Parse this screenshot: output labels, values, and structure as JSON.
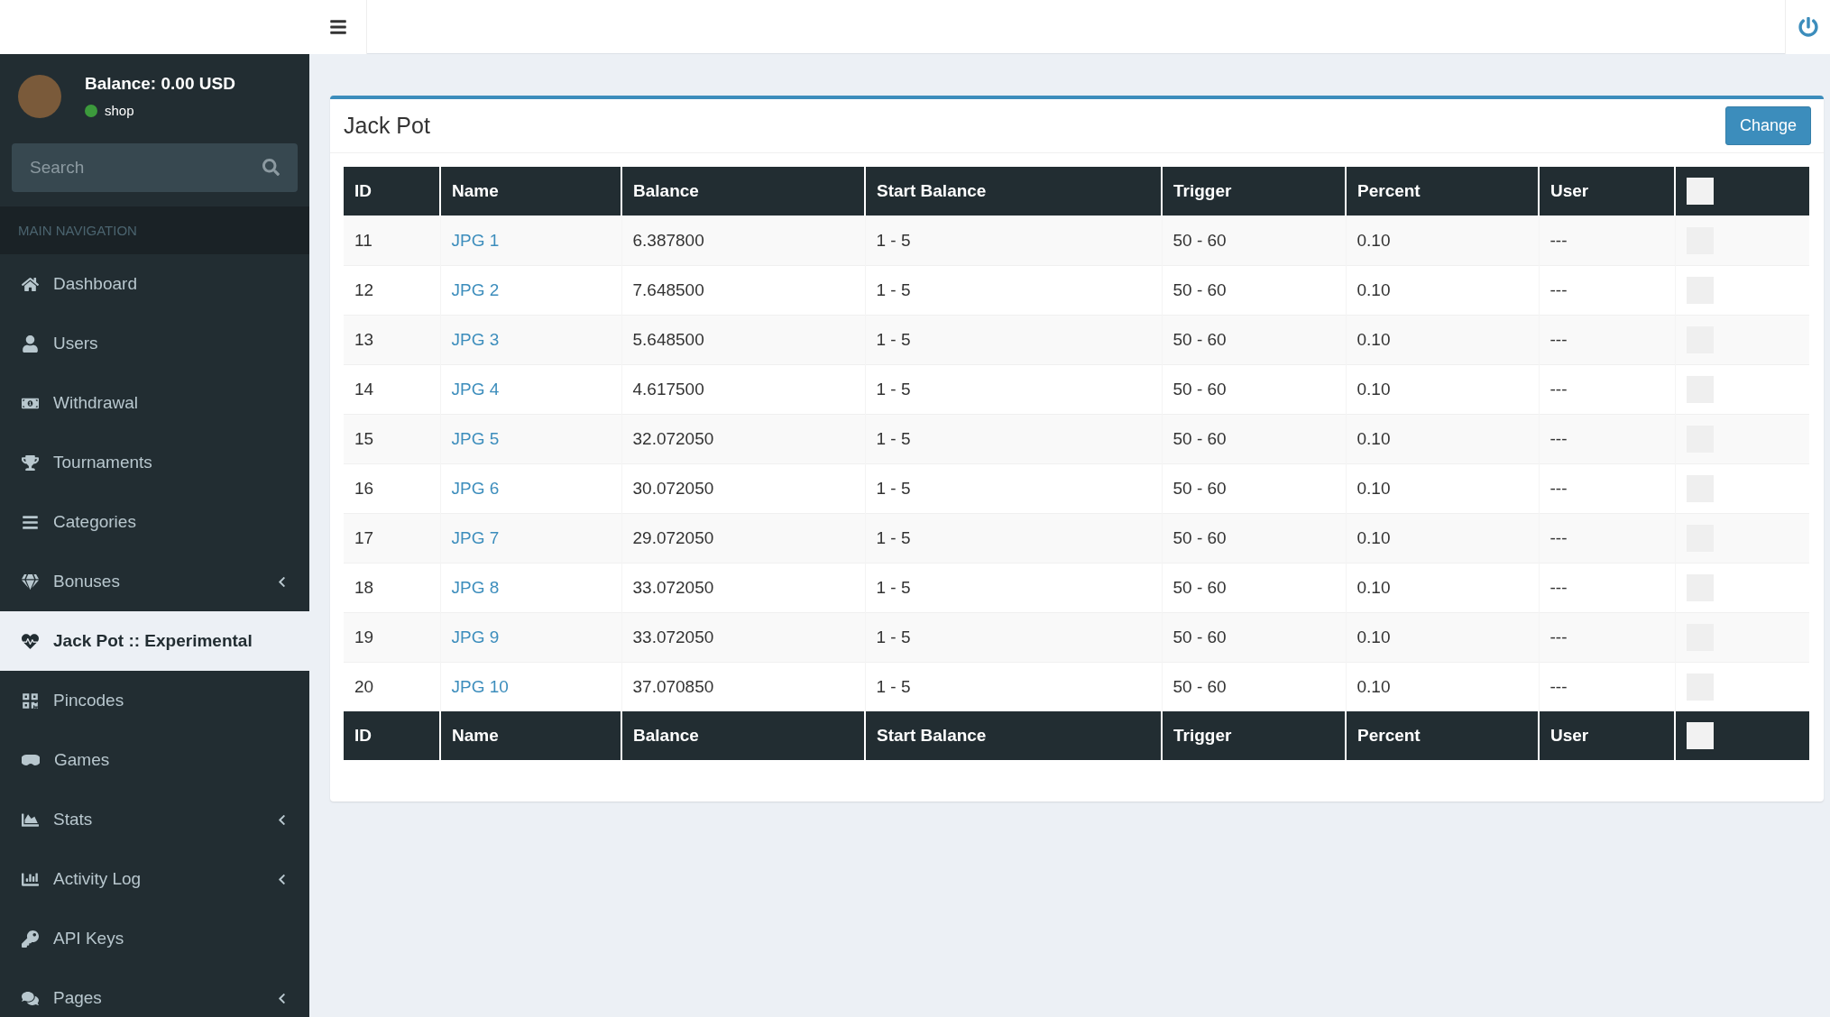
{
  "sidebar": {
    "user": {
      "balance": "Balance: 0.00 USD",
      "status": "shop"
    },
    "search": {
      "placeholder": "Search"
    },
    "nav_header": "MAIN NAVIGATION",
    "items": [
      {
        "label": "Dashboard",
        "selected": false,
        "has_submenu": false
      },
      {
        "label": "Users",
        "selected": false,
        "has_submenu": false
      },
      {
        "label": "Withdrawal",
        "selected": false,
        "has_submenu": false
      },
      {
        "label": "Tournaments",
        "selected": false,
        "has_submenu": false
      },
      {
        "label": "Categories",
        "selected": false,
        "has_submenu": false
      },
      {
        "label": "Bonuses",
        "selected": false,
        "has_submenu": true
      },
      {
        "label": "Jack Pot :: Experimental",
        "selected": true,
        "has_submenu": false
      },
      {
        "label": "Pincodes",
        "selected": false,
        "has_submenu": false
      },
      {
        "label": "Games",
        "selected": false,
        "has_submenu": false
      },
      {
        "label": "Stats",
        "selected": false,
        "has_submenu": true
      },
      {
        "label": "Activity Log",
        "selected": false,
        "has_submenu": true
      },
      {
        "label": "API Keys",
        "selected": false,
        "has_submenu": false
      },
      {
        "label": "Pages",
        "selected": false,
        "has_submenu": true
      }
    ]
  },
  "card": {
    "title": "Jack Pot",
    "button": "Change",
    "table": {
      "columns": [
        "ID",
        "Name",
        "Balance",
        "Start Balance",
        "Trigger",
        "Percent",
        "User"
      ],
      "header_checked": false,
      "rows": [
        {
          "id": "11",
          "name": "JPG 1",
          "balance": "6.387800",
          "start_balance": "1 - 5",
          "trigger": "50 - 60",
          "percent": "0.10",
          "user": "---",
          "checked": false
        },
        {
          "id": "12",
          "name": "JPG 2",
          "balance": "7.648500",
          "start_balance": "1 - 5",
          "trigger": "50 - 60",
          "percent": "0.10",
          "user": "---",
          "checked": false
        },
        {
          "id": "13",
          "name": "JPG 3",
          "balance": "5.648500",
          "start_balance": "1 - 5",
          "trigger": "50 - 60",
          "percent": "0.10",
          "user": "---",
          "checked": false
        },
        {
          "id": "14",
          "name": "JPG 4",
          "balance": "4.617500",
          "start_balance": "1 - 5",
          "trigger": "50 - 60",
          "percent": "0.10",
          "user": "---",
          "checked": false
        },
        {
          "id": "15",
          "name": "JPG 5",
          "balance": "32.072050",
          "start_balance": "1 - 5",
          "trigger": "50 - 60",
          "percent": "0.10",
          "user": "---",
          "checked": false
        },
        {
          "id": "16",
          "name": "JPG 6",
          "balance": "30.072050",
          "start_balance": "1 - 5",
          "trigger": "50 - 60",
          "percent": "0.10",
          "user": "---",
          "checked": false
        },
        {
          "id": "17",
          "name": "JPG 7",
          "balance": "29.072050",
          "start_balance": "1 - 5",
          "trigger": "50 - 60",
          "percent": "0.10",
          "user": "---",
          "checked": false
        },
        {
          "id": "18",
          "name": "JPG 8",
          "balance": "33.072050",
          "start_balance": "1 - 5",
          "trigger": "50 - 60",
          "percent": "0.10",
          "user": "---",
          "checked": false
        },
        {
          "id": "19",
          "name": "JPG 9",
          "balance": "33.072050",
          "start_balance": "1 - 5",
          "trigger": "50 - 60",
          "percent": "0.10",
          "user": "---",
          "checked": false
        },
        {
          "id": "20",
          "name": "JPG 10",
          "balance": "37.070850",
          "start_balance": "1 - 5",
          "trigger": "50 - 60",
          "percent": "0.10",
          "user": "---",
          "checked": false
        }
      ],
      "footer_columns": [
        "ID",
        "Name",
        "Balance",
        "Start Balance",
        "Trigger",
        "Percent",
        "User"
      ],
      "footer_checked": false
    }
  }
}
